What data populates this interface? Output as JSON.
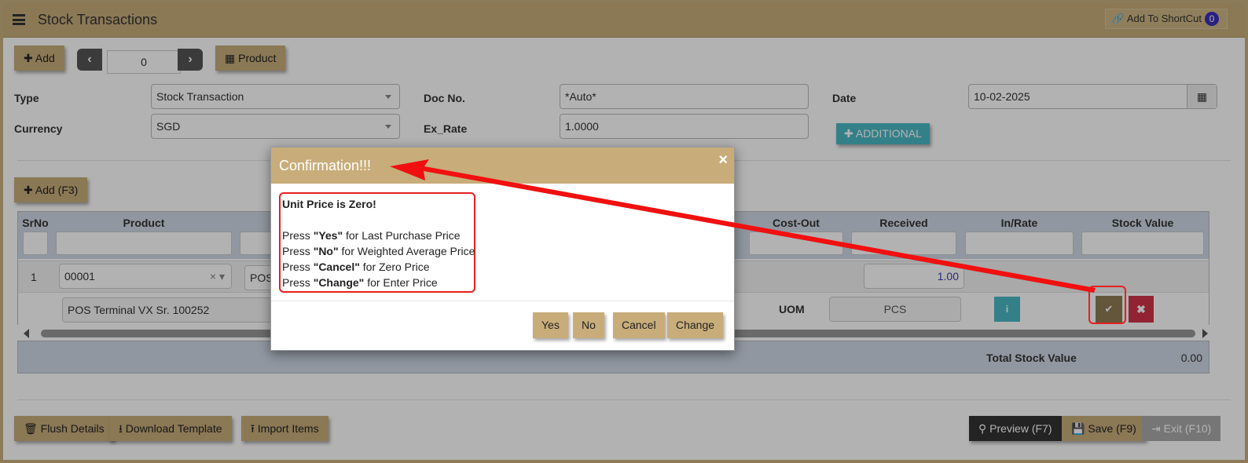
{
  "header": {
    "title": "Stock Transactions",
    "shortcut_label": "Add To ShortCut",
    "shortcut_count": "0"
  },
  "toolbar": {
    "add_label": "Add",
    "nav_value": "0",
    "product_label": "Product"
  },
  "form": {
    "type_label": "Type",
    "type_value": "Stock Transaction",
    "docno_label": "Doc No.",
    "docno_value": "*Auto*",
    "date_label": "Date",
    "date_value": "10-02-2025",
    "currency_label": "Currency",
    "currency_value": "SGD",
    "exrate_label": "Ex_Rate",
    "exrate_value": "1.0000",
    "additional_label": "ADDITIONAL"
  },
  "detail": {
    "add_label": "Add (F3)",
    "columns": [
      "SrNo",
      "Product",
      "Cost-Out",
      "Received",
      "In/Rate",
      "Stock Value"
    ],
    "row": {
      "srno": "1",
      "product_code": "00001",
      "product_partial": "POS",
      "received": "1.00",
      "description": "POS Terminal VX Sr. 100252",
      "uom_label": "UOM",
      "uom_value": "PCS"
    }
  },
  "totals": {
    "label": "Total Stock Value",
    "value": "0.00"
  },
  "footer": {
    "flush_label": "Flush Details",
    "download_label": "Download Template",
    "import_label": "Import Items",
    "preview_label": "Preview (F7)",
    "save_label": "Save (F9)",
    "exit_label": "Exit (F10)"
  },
  "dialog": {
    "title": "Confirmation!!!",
    "heading": "Unit Price is Zero!",
    "lines": [
      {
        "pre": "Press ",
        "key": "\"Yes\"",
        "post": " for Last Purchase Price"
      },
      {
        "pre": "Press ",
        "key": "\"No\"",
        "post": " for Weighted Average Price"
      },
      {
        "pre": "Press ",
        "key": "\"Cancel\"",
        "post": " for Zero Price"
      },
      {
        "pre": "Press ",
        "key": "\"Change\"",
        "post": " for Enter Price"
      }
    ],
    "buttons": {
      "yes": "Yes",
      "no": "No",
      "cancel": "Cancel",
      "change": "Change"
    }
  },
  "colors": {
    "accent": "#c8ad7a",
    "info": "#4bb8c4",
    "danger": "#d1334a",
    "annotation": "#e52020"
  }
}
